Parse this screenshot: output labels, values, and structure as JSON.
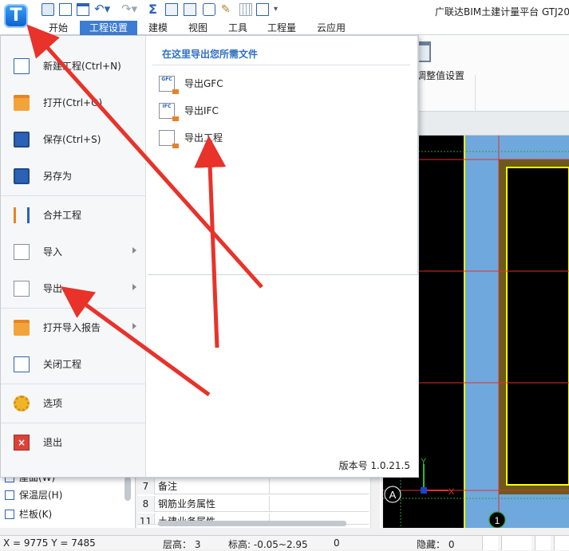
{
  "app": {
    "logo_letter": "T",
    "title": "广联达BIM土建计量平台 GTJ20"
  },
  "ribbon": {
    "tabs": [
      {
        "label": "开始"
      },
      {
        "label": "工程设置",
        "active": true
      },
      {
        "label": "建模"
      },
      {
        "label": "视图"
      },
      {
        "label": "工具"
      },
      {
        "label": "工程量"
      },
      {
        "label": "云应用"
      }
    ],
    "adjust_label": "调整值设置"
  },
  "app_menu": {
    "items": [
      {
        "label": "新建工程(Ctrl+N)",
        "icon": "new-document-icon"
      },
      {
        "label": "打开(Ctrl+O)",
        "icon": "open-folder-icon"
      },
      {
        "label": "保存(Ctrl+S)",
        "icon": "save-disk-icon"
      },
      {
        "label": "另存为",
        "icon": "save-as-icon"
      },
      {
        "label": "合并工程",
        "icon": "merge-icon"
      },
      {
        "label": "导入",
        "icon": "import-icon",
        "submenu": true
      },
      {
        "label": "导出",
        "icon": "export-icon",
        "submenu": true
      },
      {
        "label": "打开导入报告",
        "icon": "import-report-icon",
        "submenu": true
      },
      {
        "label": "关闭工程",
        "icon": "close-project-icon"
      },
      {
        "label": "选项",
        "icon": "options-gear-icon"
      },
      {
        "label": "退出",
        "icon": "exit-icon"
      }
    ],
    "submenu": {
      "heading": "在这里导出您所需文件",
      "items": [
        {
          "label": "导出GFC",
          "icon_text": "GFC"
        },
        {
          "label": "导出IFC",
          "icon_text": "IFC"
        },
        {
          "label": "导出工程",
          "icon_text": ""
        }
      ]
    },
    "version": "版本号 1.0.21.5"
  },
  "tree": {
    "items": [
      {
        "label": "屋面(W)"
      },
      {
        "label": "保温层(H)"
      },
      {
        "label": "栏板(K)"
      }
    ]
  },
  "property_table": {
    "rows": [
      {
        "num": "7",
        "name": "备注"
      },
      {
        "num": "8",
        "name": "钢筋业务属性"
      },
      {
        "num": "11",
        "name": "土建业务属性"
      }
    ]
  },
  "canvas": {
    "axis_label": "A",
    "axis_number": "1",
    "y_axis": "Y",
    "x_axis": "X"
  },
  "status": {
    "coords": "X = 9775 Y = 7485",
    "floor_height": "层高： 3",
    "elevation": "标高: -0.05~2.95",
    "count": "0",
    "hidden": "隐藏： 0"
  },
  "colors": {
    "accent": "#3d7cd3",
    "annotation_red": "#e8322a",
    "canvas_bg": "#000000",
    "wall_blue": "#6fa8dc",
    "beam_yellow": "#ffff00",
    "slab_olive": "#6b5a1a"
  }
}
